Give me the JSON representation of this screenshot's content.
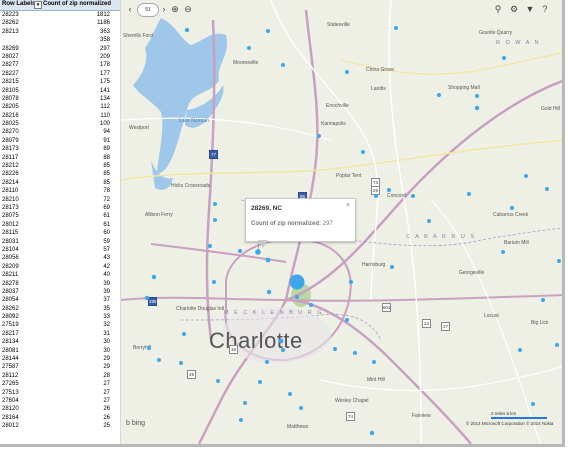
{
  "pivot": {
    "header_label": "Row Labels",
    "header_value": "Count of zip normalized",
    "rows": [
      {
        "zip": "28223",
        "count": "1812"
      },
      {
        "zip": "28262",
        "count": "1186"
      },
      {
        "zip": "28213",
        "count": "363"
      },
      {
        "zip": "",
        "count": "358"
      },
      {
        "zip": "28269",
        "count": "297"
      },
      {
        "zip": "28027",
        "count": "209"
      },
      {
        "zip": "28277",
        "count": "178"
      },
      {
        "zip": "28227",
        "count": "177"
      },
      {
        "zip": "28215",
        "count": "175"
      },
      {
        "zip": "28105",
        "count": "141"
      },
      {
        "zip": "28078",
        "count": "134"
      },
      {
        "zip": "28205",
        "count": "112"
      },
      {
        "zip": "28216",
        "count": "110"
      },
      {
        "zip": "28025",
        "count": "100"
      },
      {
        "zip": "28270",
        "count": "94"
      },
      {
        "zip": "28079",
        "count": "91"
      },
      {
        "zip": "28173",
        "count": "89"
      },
      {
        "zip": "28117",
        "count": "88"
      },
      {
        "zip": "28212",
        "count": "85"
      },
      {
        "zip": "28226",
        "count": "85"
      },
      {
        "zip": "28214",
        "count": "85"
      },
      {
        "zip": "28110",
        "count": "78"
      },
      {
        "zip": "28210",
        "count": "72"
      },
      {
        "zip": "28173",
        "count": "69"
      },
      {
        "zip": "28075",
        "count": "61"
      },
      {
        "zip": "28012",
        "count": "61"
      },
      {
        "zip": "28115",
        "count": "60"
      },
      {
        "zip": "28031",
        "count": "59"
      },
      {
        "zip": "28104",
        "count": "57"
      },
      {
        "zip": "28056",
        "count": "43"
      },
      {
        "zip": "28209",
        "count": "42"
      },
      {
        "zip": "28211",
        "count": "40"
      },
      {
        "zip": "28278",
        "count": "39"
      },
      {
        "zip": "28037",
        "count": "39"
      },
      {
        "zip": "28054",
        "count": "37"
      },
      {
        "zip": "28262",
        "count": "35"
      },
      {
        "zip": "28092",
        "count": "33"
      },
      {
        "zip": "27519",
        "count": "32"
      },
      {
        "zip": "28217",
        "count": "31"
      },
      {
        "zip": "28134",
        "count": "30"
      },
      {
        "zip": "28081",
        "count": "30"
      },
      {
        "zip": "28144",
        "count": "29"
      },
      {
        "zip": "27587",
        "count": "29"
      },
      {
        "zip": "28112",
        "count": "28"
      },
      {
        "zip": "27265",
        "count": "27"
      },
      {
        "zip": "27513",
        "count": "27"
      },
      {
        "zip": "27604",
        "count": "27"
      },
      {
        "zip": "28120",
        "count": "26"
      },
      {
        "zip": "28164",
        "count": "26"
      },
      {
        "zip": "28012",
        "count": "25"
      }
    ]
  },
  "map": {
    "big_city": "Charlotte",
    "zoom_label": "51",
    "labels": {
      "statesville": "Statesville",
      "granite_quarry": "Granite Quarry",
      "rowan": "R O W A N",
      "sherrills_ford": "Sherrills Ford",
      "mooresville": "Mooresville",
      "china_grove": "China Grove",
      "landis": "Landis",
      "enochville": "Enochville",
      "gold_hill": "Gold Hill",
      "shopping_mall": "Shopping Mall",
      "westport": "Westport",
      "lake_norman": "Lake Norman",
      "kannapolis": "Kannapolis",
      "hicks": "Hicks Crossroads",
      "concord": "Concord",
      "poplar_tent": "Poplar Tent",
      "cabarrus": "C A B A R R U S",
      "alison_ferry": "Allison Ferry",
      "harrisburg": "Harrisburg",
      "georgeville": "Georgeville",
      "barium": "Barium Mill",
      "cabarrus_ck": "Cabarrus Creek",
      "mecklenburg": "M E C K L E N B U R G",
      "locust": "Locust",
      "big_lick": "Big Lick",
      "berryhill": "Berryhill",
      "mint_hill": "Mint Hill",
      "fairview": "Fairview",
      "matthews": "Matthews",
      "wesley": "Wesley Chapel",
      "charlotte_airport": "Charlotte Douglas Intl",
      "new_salem": "New Salem"
    },
    "shields": [
      "77",
      "85",
      "485",
      "73",
      "29",
      "24",
      "27",
      "601",
      "49",
      "16",
      "74"
    ],
    "tooltip": {
      "title": "28269, NC",
      "close": "×",
      "metric_label": "Count of zip normalized:",
      "metric_value": "297"
    },
    "bing_logo": "b bing",
    "scale_text": "2 miles   5 km",
    "copyright": "© 2014 Microsoft Corporation  © 2014 Nokia",
    "colors": {
      "bubble": "#3ea6e9",
      "water": "#9fc7ea",
      "roads": "#c9a0c2",
      "land": "#eef0e6"
    }
  }
}
